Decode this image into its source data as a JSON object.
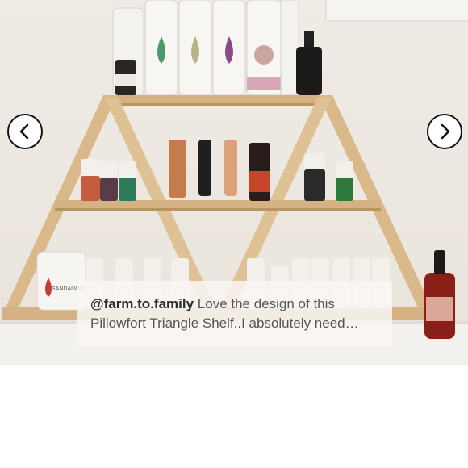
{
  "carousel": {
    "prev_icon": "chevron-left-icon",
    "next_icon": "chevron-right-icon",
    "button_border_color": "#111111"
  },
  "caption": {
    "username": "@farm.to.family",
    "line1": "Love the design of this",
    "line2": "Pillowfort Triangle Shelf..I absolutely need…"
  },
  "photo": {
    "product_label": "SANDALWOOD"
  },
  "colors": {
    "wood": "#d9b98a",
    "wall": "#ece7e0"
  }
}
